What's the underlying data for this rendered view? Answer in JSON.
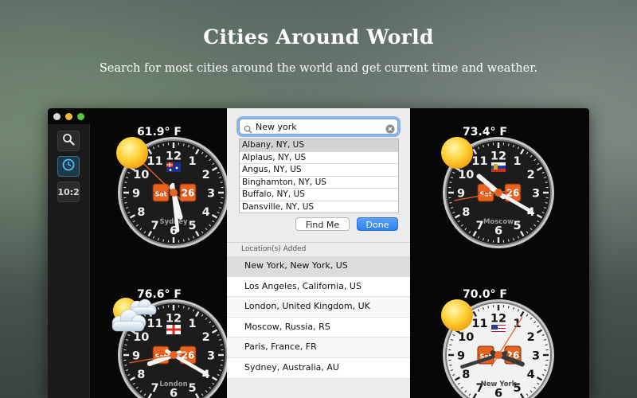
{
  "header": {
    "title": "Cities Around World",
    "subtitle": "Search for most cities around the world and get current time and weather."
  },
  "sidebar": {
    "items": [
      {
        "icon": "magnifier-icon"
      },
      {
        "icon": "clock-icon"
      },
      {
        "label": "10:2"
      }
    ]
  },
  "clock_numbers": [
    "12",
    "1",
    "2",
    "3",
    "4",
    "5",
    "6",
    "7",
    "8",
    "9",
    "10",
    "11"
  ],
  "clocks": [
    {
      "temperature": "61.9° F",
      "city": "Sydney",
      "day": "Sat",
      "date": "26",
      "weather": "sunny",
      "theme": "dark",
      "hour": 5,
      "minute": 29
    },
    {
      "temperature": "73.4° F",
      "city": "Moscow",
      "day": "Sat",
      "date": "26",
      "weather": "sunny",
      "theme": "dark",
      "hour": 10,
      "minute": 20
    },
    {
      "temperature": "76.6° F",
      "city": "London",
      "day": "Sat",
      "date": "26",
      "weather": "partly-cloudy",
      "theme": "dark",
      "hour": 8,
      "minute": 20
    },
    {
      "temperature": "70.0° F",
      "city": "New York",
      "day": "Sat",
      "date": "26",
      "weather": "sunny",
      "theme": "light",
      "hour": 3,
      "minute": 42
    }
  ],
  "search": {
    "value": "New york"
  },
  "results": [
    "Albany, NY, US",
    "Alplaus, NY, US",
    "Angus, NY, US",
    "Binghamton, NY, US",
    "Buffalo, NY, US",
    "Dansville, NY, US"
  ],
  "buttons": {
    "find_me": "Find Me",
    "done": "Done"
  },
  "locations": {
    "header": "Location(s) Added",
    "items": [
      "New York, New York, US",
      "Los Angeles, California, US",
      "London, United Kingdom, UK",
      "Moscow, Russia, RS",
      "Paris, France, FR",
      "Sydney, Australia, AU"
    ]
  }
}
